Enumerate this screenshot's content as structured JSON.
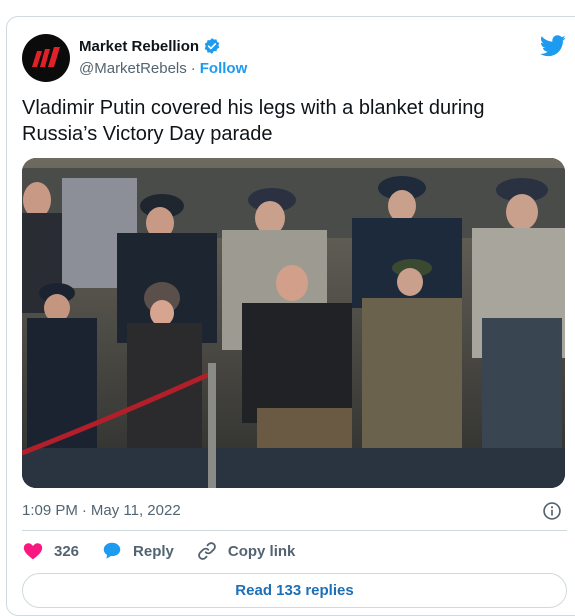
{
  "author": {
    "display_name": "Market Rebellion",
    "handle": "@MarketRebels",
    "separator": "·",
    "follow_label": "Follow",
    "avatar_icon": "market-rebellion-logo-icon",
    "verified_icon": "verified-badge-icon"
  },
  "tweet": {
    "text": "Vladimir Putin covered his legs with a blanket during Russia’s Victory Day parade"
  },
  "media": {
    "image_subject": "parade-grandstand-photo"
  },
  "meta": {
    "time": "1:09 PM",
    "separator": "·",
    "date": "May 11, 2022"
  },
  "actions": {
    "like_count": "326",
    "reply_label": "Reply",
    "copy_link_label": "Copy link"
  },
  "footer": {
    "read_replies_label": "Read 133 replies"
  },
  "colors": {
    "brand_blue": "#1d9bf0",
    "like_pink": "#f91880",
    "muted_text": "#536471",
    "border": "#cfd9de"
  }
}
